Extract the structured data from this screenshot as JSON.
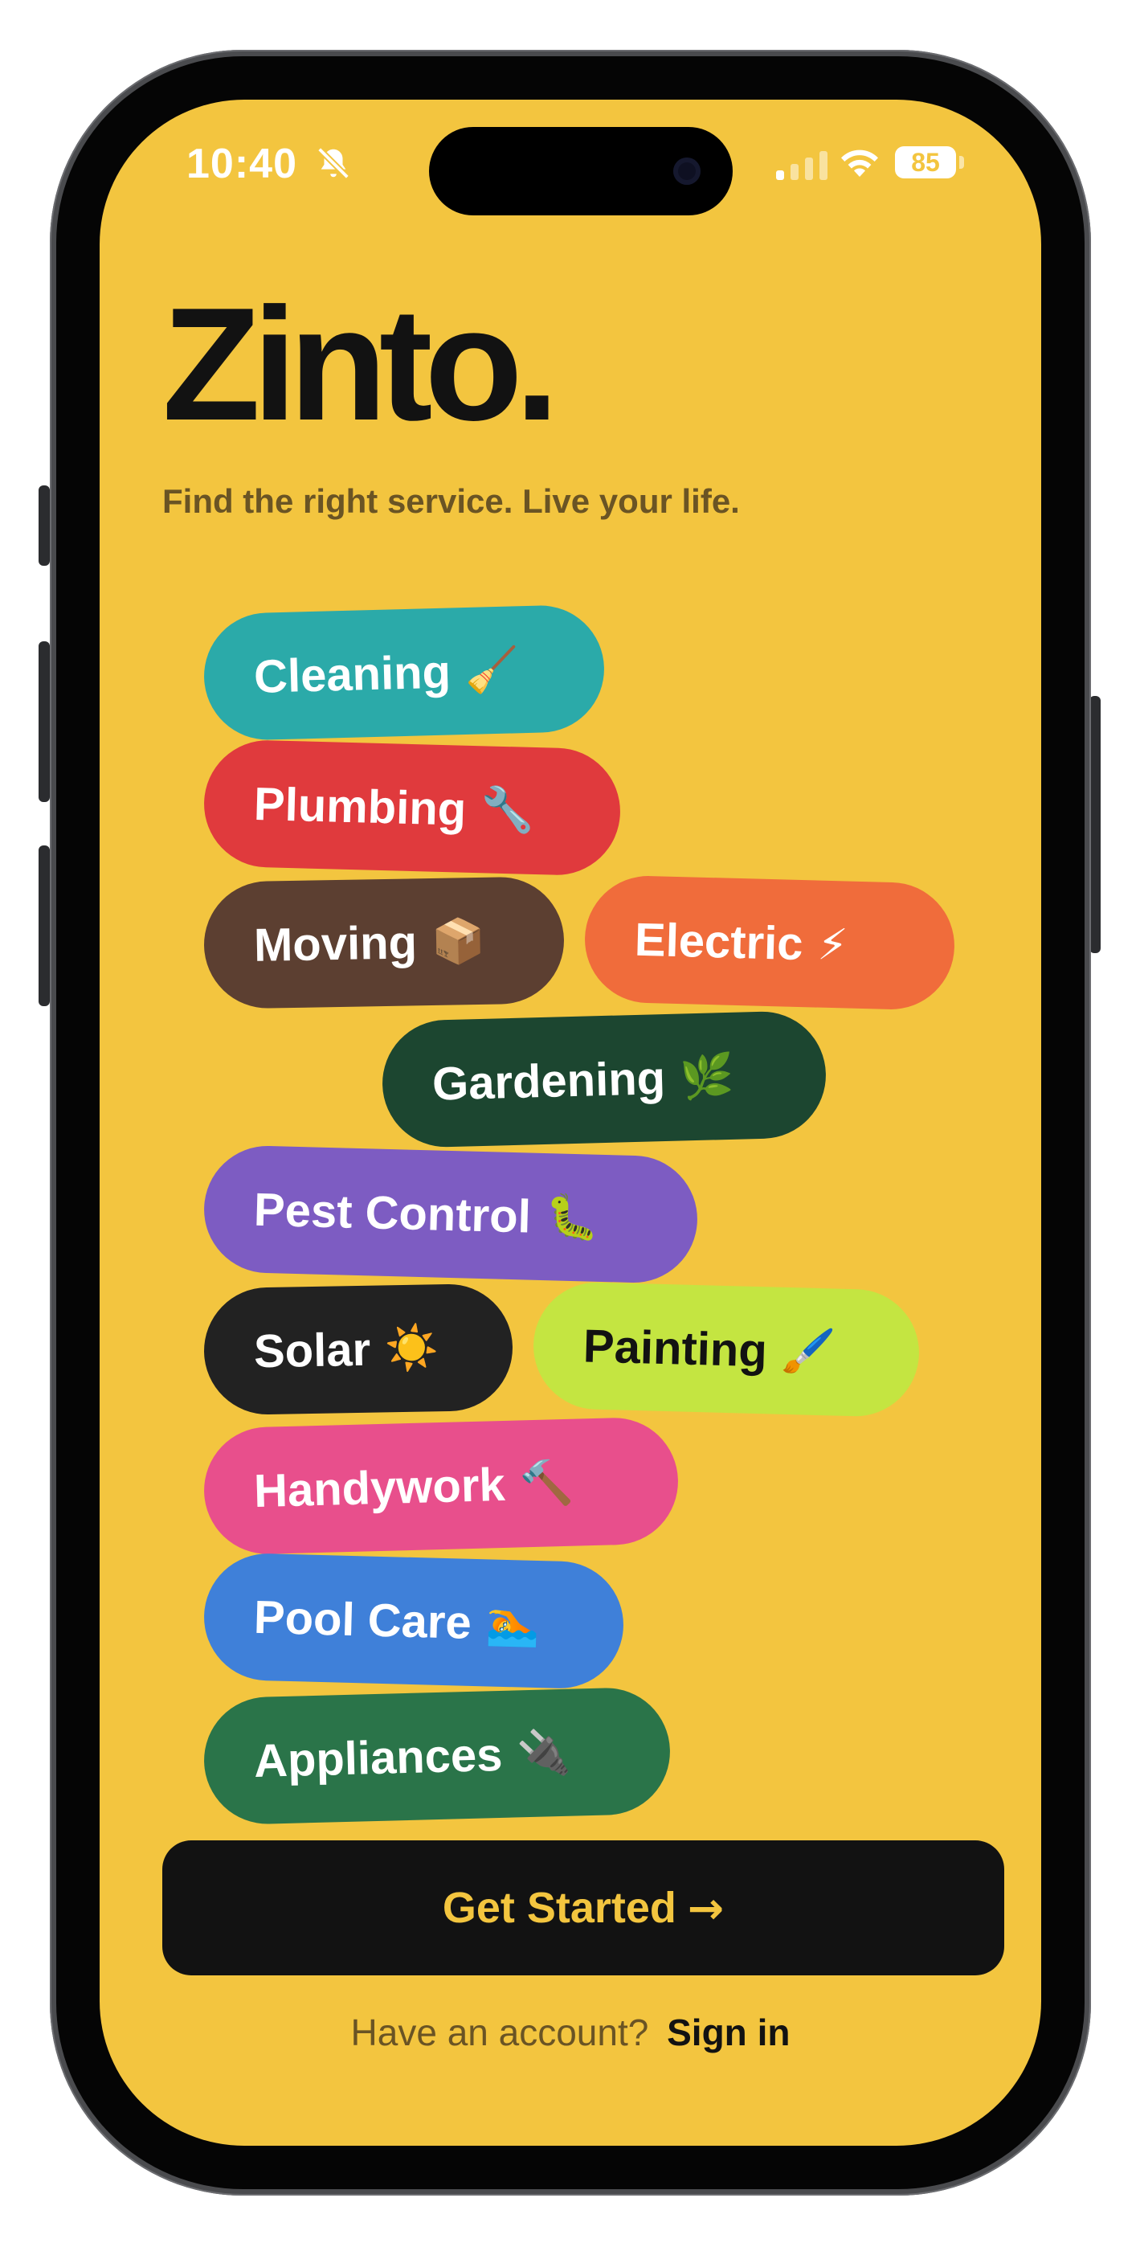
{
  "status_bar": {
    "time": "10:40",
    "battery": "85",
    "icons": [
      "bell-slash-icon",
      "signal-icon",
      "wifi-icon",
      "battery-icon"
    ]
  },
  "app": {
    "title": "Zinto.",
    "tagline": "Find the right service. Live your life."
  },
  "services": [
    {
      "label": "Cleaning",
      "emoji": "🧹",
      "bg": "#2baaa9",
      "fg": "#ffffff"
    },
    {
      "label": "Plumbing",
      "emoji": "🔧",
      "bg": "#e03a3d",
      "fg": "#ffffff"
    },
    {
      "label": "Moving",
      "emoji": "📦",
      "bg": "#5c3f31",
      "fg": "#ffffff"
    },
    {
      "label": "Electric",
      "emoji": "⚡",
      "bg": "#f06c3b",
      "fg": "#ffffff"
    },
    {
      "label": "Gardening",
      "emoji": "🌿",
      "bg": "#1c4630",
      "fg": "#ffffff"
    },
    {
      "label": "Pest Control",
      "emoji": "🐛",
      "bg": "#7d5cc2",
      "fg": "#ffffff"
    },
    {
      "label": "Solar",
      "emoji": "☀️",
      "bg": "#222222",
      "fg": "#ffffff"
    },
    {
      "label": "Painting",
      "emoji": "🖌️",
      "bg": "#c4e541",
      "fg": "#121212"
    },
    {
      "label": "Handywork",
      "emoji": "🔨",
      "bg": "#e84f8c",
      "fg": "#ffffff"
    },
    {
      "label": "Pool Care",
      "emoji": "🏊",
      "bg": "#3f80d9",
      "fg": "#ffffff"
    },
    {
      "label": "Appliances",
      "emoji": "🔌",
      "bg": "#2a7449",
      "fg": "#ffffff"
    }
  ],
  "cta": {
    "label": "Get Started",
    "arrow": "→"
  },
  "signin": {
    "prompt": "Have an account?",
    "link": "Sign in"
  },
  "colors": {
    "background": "#f3c53f",
    "text_dark": "#121212",
    "text_muted": "#6a5424"
  }
}
